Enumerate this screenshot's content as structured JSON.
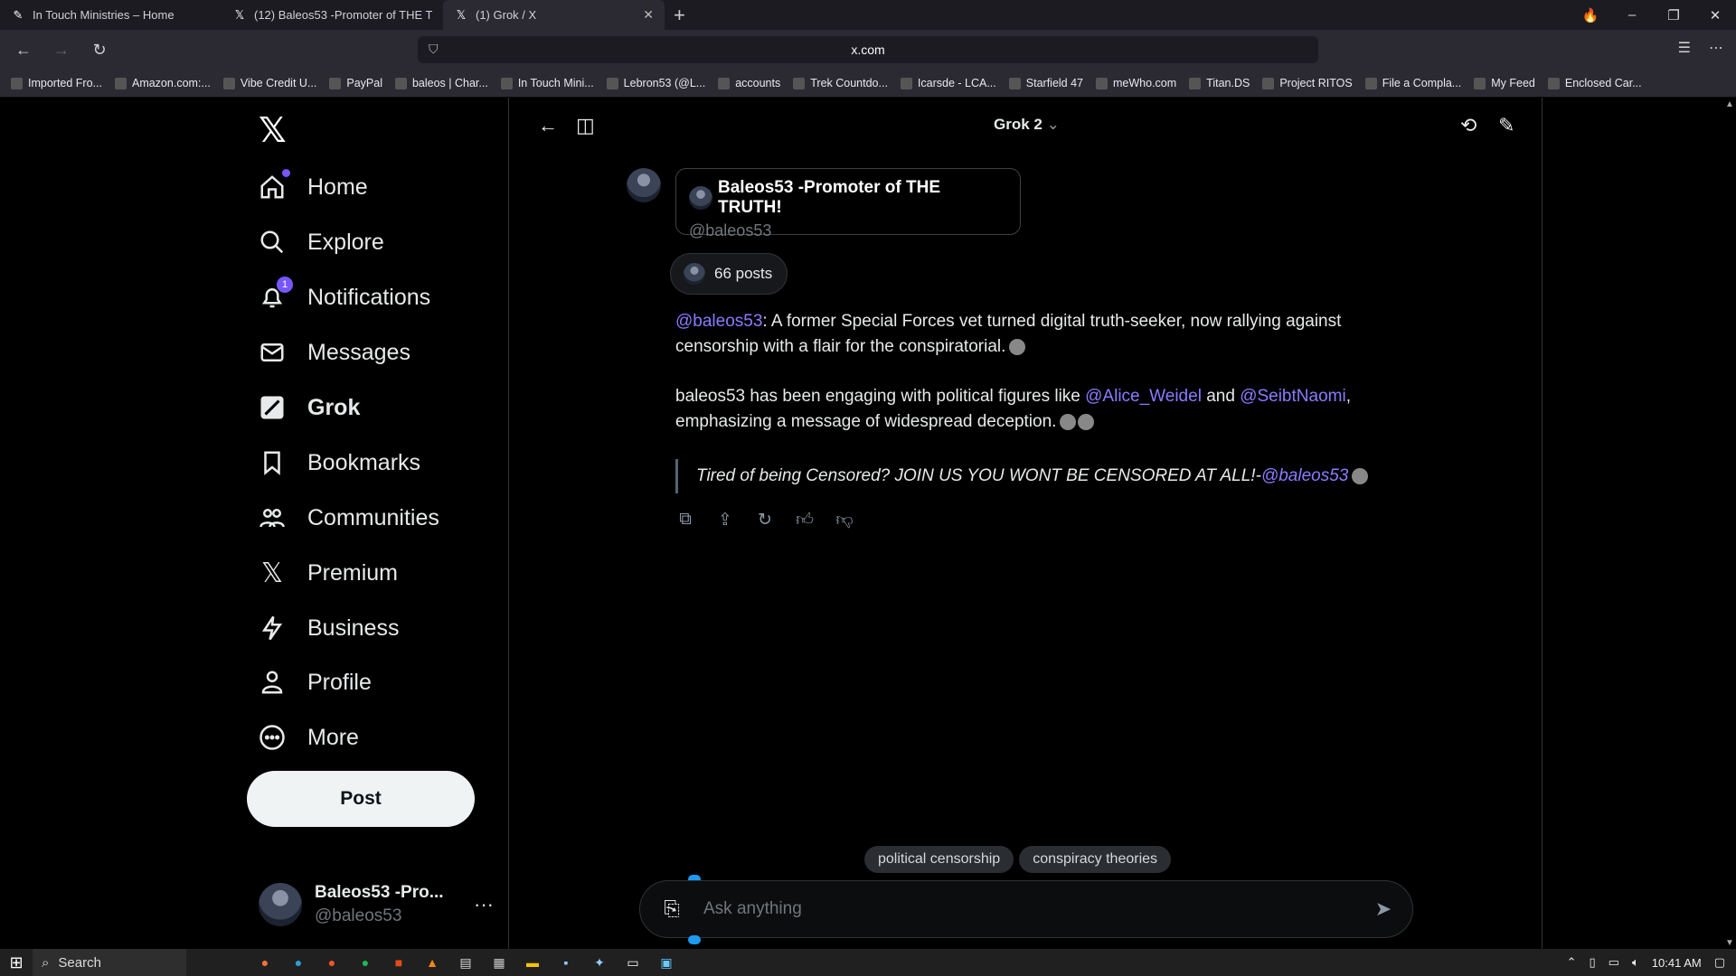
{
  "browser": {
    "tabs": [
      {
        "title": "In Touch Ministries – Home",
        "icon": "ministry-icon"
      },
      {
        "title": "(12) Baleos53 -Promoter of THE T",
        "icon": "x-icon"
      },
      {
        "title": "(1) Grok / X",
        "icon": "x-icon",
        "active": true
      }
    ],
    "url": "x.com",
    "bookmarks": [
      "Imported Fro...",
      "Amazon.com:...",
      "Vibe Credit U...",
      "PayPal",
      "baleos | Char...",
      "In Touch Mini...",
      "Lebron53 (@L...",
      "accounts",
      "Trek Countdo...",
      "Icarsde - LCA...",
      "Starfield 47",
      "meWho.com",
      "Titan.DS",
      "Project RITOS",
      "File a Compla...",
      "My Feed",
      "Enclosed Car..."
    ]
  },
  "sidebar": {
    "items": [
      {
        "label": "Home",
        "icon": "home-icon"
      },
      {
        "label": "Explore",
        "icon": "search-icon"
      },
      {
        "label": "Notifications",
        "icon": "bell-icon",
        "badge": "1"
      },
      {
        "label": "Messages",
        "icon": "mail-icon"
      },
      {
        "label": "Grok",
        "icon": "grok-icon"
      },
      {
        "label": "Bookmarks",
        "icon": "bookmark-icon"
      },
      {
        "label": "Communities",
        "icon": "communities-icon"
      },
      {
        "label": "Premium",
        "icon": "x-icon"
      },
      {
        "label": "Business",
        "icon": "lightning-icon"
      },
      {
        "label": "Profile",
        "icon": "person-icon"
      },
      {
        "label": "More",
        "icon": "more-circle-icon"
      }
    ],
    "post_label": "Post",
    "account": {
      "name": "Baleos53 -Pro...",
      "handle": "@baleos53"
    }
  },
  "grok": {
    "model": "Grok 2",
    "card": {
      "name": "Baleos53 -Promoter of THE TRUTH!",
      "handle": "@baleos53"
    },
    "posts_count": "66 posts",
    "para1": {
      "mention": "@baleos53",
      "text": ": A former Special Forces vet turned digital truth-seeker, now rallying against censorship with a flair for the conspiratorial."
    },
    "para2": {
      "text_a": "baleos53 has been engaging with political figures like ",
      "mention_a": "@Alice_Weidel",
      "text_b": " and ",
      "mention_b": "@SeibtNaomi",
      "text_c": ", emphasizing a message of widespread deception."
    },
    "quote": {
      "text": "Tired of being Censored? JOIN US YOU WONT BE CENSORED AT ALL!-",
      "mention": "@baleos53"
    },
    "suggestions": [
      "political censorship",
      "conspiracy theories"
    ],
    "input_placeholder": "Ask anything"
  },
  "taskbar": {
    "search_label": "Search",
    "time": "10:41 AM"
  }
}
